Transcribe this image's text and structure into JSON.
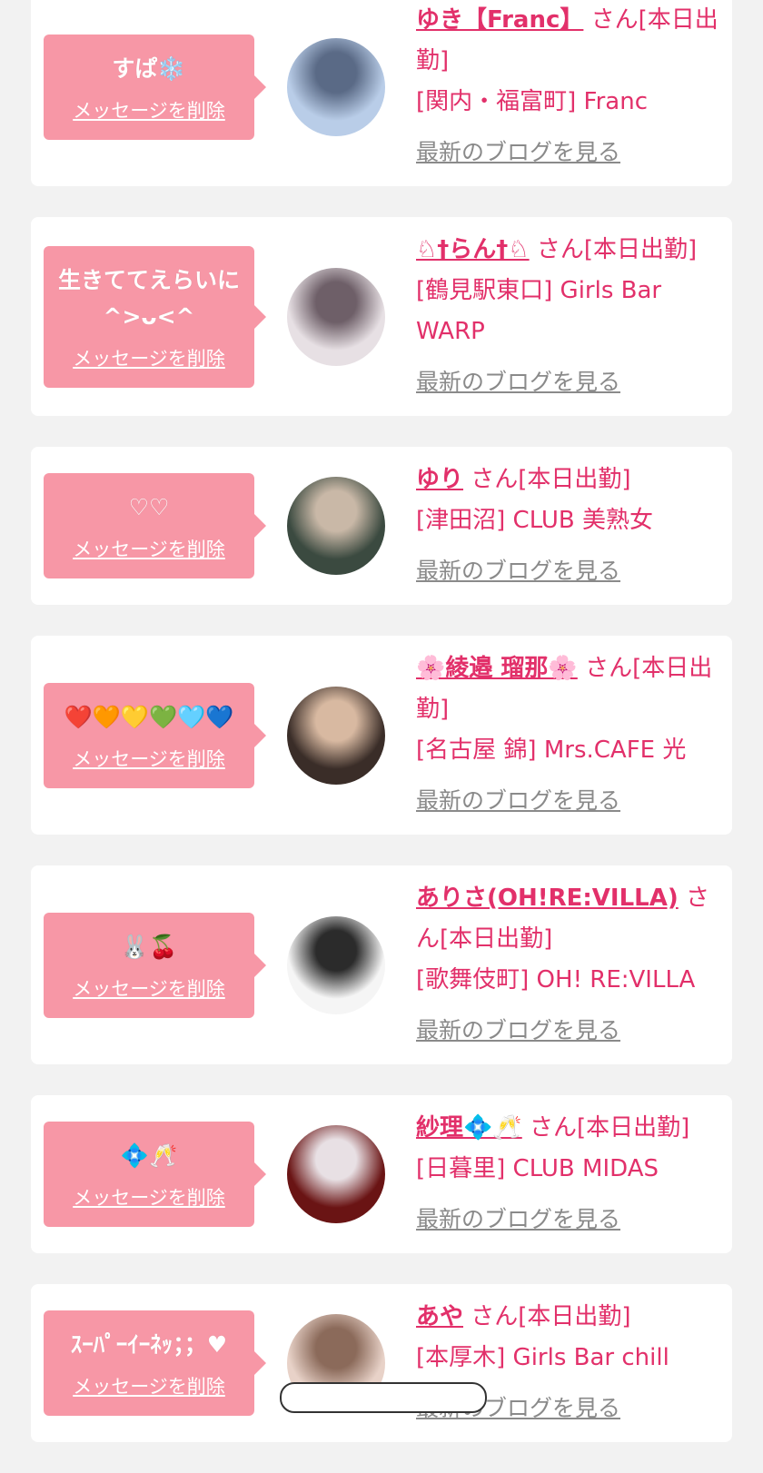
{
  "cards": [
    {
      "message": "すぱ❄️",
      "delete_label": "メッセージを削除",
      "name": "ゆき【Franc】",
      "suffix": "さん[本日出勤]",
      "shop": "[関内・福富町] Franc",
      "blog_label": "最新のブログを見る",
      "avatar_colors": [
        "#b9cde8",
        "#5a6a86"
      ]
    },
    {
      "message": "生きててえらいに ^>ᴗ<^",
      "delete_label": "メッセージを削除",
      "name": "♘†らん†♘",
      "suffix": "さん[本日出勤]",
      "shop": "[鶴見駅東口] Girls Bar WARP",
      "blog_label": "最新のブログを見る",
      "avatar_colors": [
        "#e7e0e4",
        "#6e5f68"
      ]
    },
    {
      "message": "♡♡",
      "delete_label": "メッセージを削除",
      "name": "ゆり",
      "suffix": "さん[本日出勤]",
      "shop": "[津田沼] CLUB 美熟女",
      "blog_label": "最新のブログを見る",
      "avatar_colors": [
        "#3b4a40",
        "#c9b8a7"
      ]
    },
    {
      "message": "❤️🧡💛💚🩵💙",
      "delete_label": "メッセージを削除",
      "name": "🌸綾邉 瑠那🌸",
      "suffix": "さん[本日出勤]",
      "shop": "[名古屋 錦] Mrs.CAFE 光",
      "blog_label": "最新のブログを見る",
      "avatar_colors": [
        "#3a2d28",
        "#d8b9a1"
      ]
    },
    {
      "message": "🐰🍒",
      "delete_label": "メッセージを削除",
      "name": "ありさ(OH!RE:VILLA)",
      "suffix": "さん[本日出勤]",
      "shop": "[歌舞伎町] OH! RE:VILLA",
      "blog_label": "最新のブログを見る",
      "avatar_colors": [
        "#f5f5f5",
        "#2b2b2b"
      ]
    },
    {
      "message": "💠🥂",
      "delete_label": "メッセージを削除",
      "name": "紗理💠🥂",
      "suffix": "さん[本日出勤]",
      "shop": "[日暮里] CLUB MIDAS",
      "blog_label": "最新のブログを見る",
      "avatar_colors": [
        "#6a1414",
        "#e8e0e4"
      ]
    },
    {
      "message": "ｽｰﾊﾟｰｲｰﾈｯ；；♥",
      "delete_label": "メッセージを削除",
      "name": "あや",
      "suffix": "さん[本日出勤]",
      "shop": "[本厚木] Girls Bar chill",
      "blog_label": "最新のブログを見る",
      "avatar_colors": [
        "#e8d2c8",
        "#8b6a5a"
      ]
    }
  ]
}
